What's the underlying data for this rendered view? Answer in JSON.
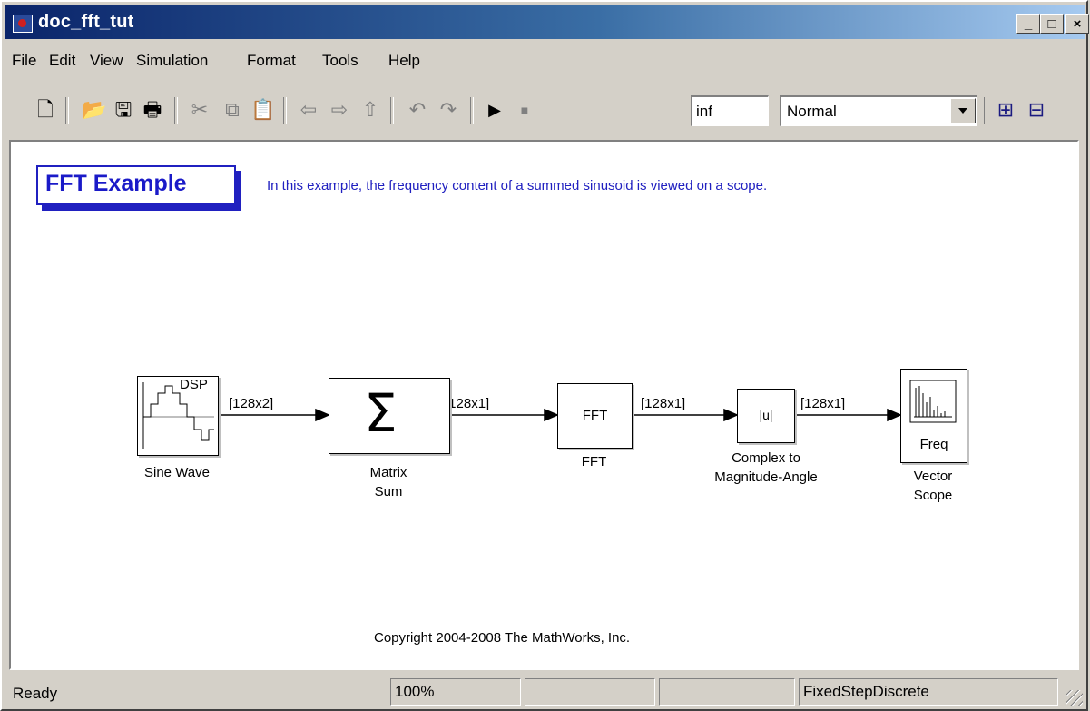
{
  "window": {
    "title": "doc_fft_tut"
  },
  "titlebar_buttons": {
    "minimize": "_",
    "maximize": "□",
    "close": "×"
  },
  "menu": [
    "File",
    "Edit",
    "View",
    "Simulation",
    "Format",
    "Tools",
    "Help"
  ],
  "toolbar": {
    "icons": [
      "new-icon",
      "open-icon",
      "save-icon",
      "print-icon",
      "cut-icon",
      "copy-icon",
      "paste-icon",
      "back-icon",
      "forward-icon",
      "up-icon",
      "undo-icon",
      "redo-icon",
      "start-icon",
      "stop-icon",
      "library-browser-icon",
      "model-explorer-icon"
    ],
    "stop_time": "inf",
    "sim_mode": "Normal"
  },
  "diagram": {
    "title": "FFT Example",
    "description": "In this example, the frequency content of a summed sinusoid is viewed on a scope.",
    "blocks": {
      "sine": {
        "inner": "DSP",
        "label": "Sine Wave"
      },
      "sum": {
        "label_line1": "Matrix",
        "label_line2": "Sum"
      },
      "fft": {
        "inner": "FFT",
        "label": "FFT"
      },
      "cmag": {
        "inner": "|u|",
        "label_line1": "Complex to",
        "label_line2": "Magnitude-Angle"
      },
      "scope": {
        "inner": "Freq",
        "label_line1": "Vector",
        "label_line2": "Scope"
      }
    },
    "signals": [
      "[128x2]",
      "[128x1]",
      "[128x1]",
      "[128x1]"
    ],
    "copyright": "Copyright 2004-2008 The MathWorks, Inc."
  },
  "status": {
    "state": "Ready",
    "zoom": "100%",
    "pane3": "",
    "pane4": "",
    "solver": "FixedStepDiscrete"
  },
  "colors": {
    "annotation": "#2020c0",
    "title_bar_start": "#0a246a",
    "title_bar_end": "#a6caf0"
  }
}
